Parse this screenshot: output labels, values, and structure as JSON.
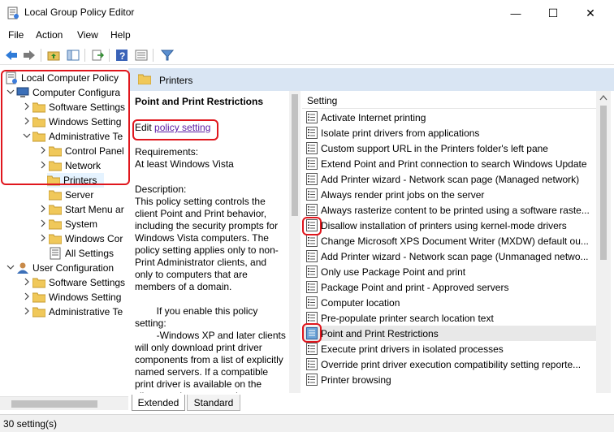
{
  "window": {
    "title": "Local Group Policy Editor",
    "minimize_glyph": "—",
    "maximize_glyph": "☐",
    "close_glyph": "✕"
  },
  "menu": {
    "items": [
      "File",
      "Action",
      "View",
      "Help"
    ]
  },
  "toolbar": {
    "buttons": [
      "back-icon",
      "forward-icon",
      "up-folder-icon",
      "show-hide-tree-icon",
      "export-list-icon",
      "help-icon",
      "properties-icon",
      "filter-icon"
    ]
  },
  "tree": {
    "items": [
      {
        "label": "Local Computer Policy",
        "icon": "policy-document-icon"
      },
      {
        "label": "Computer Configura",
        "icon": "computer-icon"
      },
      {
        "label": "Software Settings",
        "icon": "folder-icon"
      },
      {
        "label": "Windows Setting",
        "icon": "folder-icon"
      },
      {
        "label": "Administrative Te",
        "icon": "folder-icon"
      },
      {
        "label": "Control Panel",
        "icon": "folder-icon"
      },
      {
        "label": "Network",
        "icon": "folder-icon"
      },
      {
        "label": "Printers",
        "icon": "folder-icon"
      },
      {
        "label": "Server",
        "icon": "folder-icon"
      },
      {
        "label": "Start Menu ar",
        "icon": "folder-icon"
      },
      {
        "label": "System",
        "icon": "folder-icon"
      },
      {
        "label": "Windows Cor",
        "icon": "folder-icon"
      },
      {
        "label": "All Settings",
        "icon": "all-settings-icon"
      },
      {
        "label": "User Configuration",
        "icon": "user-icon"
      },
      {
        "label": "Software Settings",
        "icon": "folder-icon"
      },
      {
        "label": "Windows Setting",
        "icon": "folder-icon"
      },
      {
        "label": "Administrative Te",
        "icon": "folder-icon"
      }
    ]
  },
  "header": {
    "title": "Printers"
  },
  "description": {
    "policy_title": "Point and Print Restrictions",
    "edit_prefix": "Edit ",
    "edit_link": "policy setting",
    "requirements_label": "Requirements:",
    "requirements_value": "At least Windows Vista",
    "body": "Description:\nThis policy setting controls the client Point and Print behavior, including the security prompts for Windows Vista computers. The policy setting applies only to non-Print Administrator clients, and only to computers that are members of a domain.\n\n        If you enable this policy setting:\n        -Windows XP and later clients will only download print driver components from a list of explicitly named servers. If a compatible print driver is available on the client, a printer connection"
  },
  "list": {
    "column_header": "Setting",
    "selected_index": 14,
    "items": [
      "Activate Internet printing",
      "Isolate print drivers from applications",
      "Custom support URL in the Printers folder's left pane",
      "Extend Point and Print connection to search Windows Update",
      "Add Printer wizard - Network scan page (Managed network)",
      "Always render print jobs on the server",
      "Always rasterize content to be printed using a software raste...",
      "Disallow installation of printers using kernel-mode drivers",
      "Change Microsoft XPS Document Writer (MXDW) default ou...",
      "Add Printer wizard - Network scan page (Unmanaged netwo...",
      "Only use Package Point and print",
      "Package Point and print - Approved servers",
      "Computer location",
      "Pre-populate printer search location text",
      "Point and Print Restrictions",
      "Execute print drivers in isolated processes",
      "Override print driver execution compatibility setting reporte...",
      "Printer browsing"
    ]
  },
  "tabs": {
    "extended": "Extended",
    "standard": "Standard",
    "active": "Extended"
  },
  "status": {
    "text": "30 setting(s)"
  },
  "colors": {
    "annotation_red": "#e0161d",
    "header_band": "#d9e5f3",
    "selection": "#e5f3ff",
    "link": "#5a1ba3"
  }
}
